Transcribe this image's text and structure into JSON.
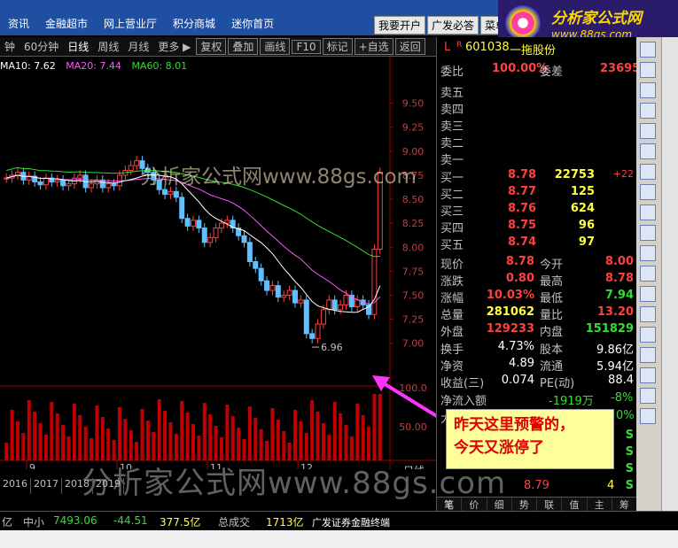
{
  "topbar": {
    "nav": [
      "资讯",
      "金融超市",
      "网上营业厅",
      "积分商城",
      "迷你首页"
    ],
    "right_buttons": [
      "我要开户",
      "广发必答",
      "菜单"
    ]
  },
  "logo": {
    "title": "分析家公式网",
    "url": "www.88gs.com"
  },
  "toolbar": {
    "items": [
      "钟",
      "60分钟",
      "日线",
      "周线",
      "月线",
      "更多 ▶"
    ],
    "active": "日线",
    "buttons": [
      "复权",
      "叠加",
      "画线",
      "F10",
      "标记",
      "+自选",
      "返回"
    ]
  },
  "ma_legend": [
    {
      "label": "MA10: 7.62",
      "color": "#ffffff"
    },
    {
      "label": "MA20: 7.44",
      "color": "#ff55ff"
    },
    {
      "label": "MA60: 8.01",
      "color": "#33dd33"
    }
  ],
  "chart_data": {
    "type": "candlestick",
    "y_ticks": [
      "9.50",
      "9.25",
      "9.00",
      "8.75",
      "8.50",
      "8.25",
      "8.00",
      "7.75",
      "7.50",
      "7.25",
      "7.00"
    ],
    "ylim": [
      6.85,
      9.8
    ],
    "low_marker": "6.96",
    "volume_ticks": [
      "100.0",
      "50.00"
    ],
    "x_month_labels": [
      "9",
      "10",
      "11",
      "12"
    ],
    "period_labels": [
      "2016",
      "2017",
      "2018",
      "2019"
    ],
    "period_label": "日线",
    "closes": [
      8.72,
      8.75,
      8.78,
      8.7,
      8.74,
      8.68,
      8.65,
      8.72,
      8.68,
      8.7,
      8.64,
      8.66,
      8.72,
      8.75,
      8.62,
      8.66,
      8.7,
      8.62,
      8.66,
      8.64,
      8.75,
      8.8,
      8.85,
      8.9,
      8.82,
      8.78,
      8.7,
      8.6,
      8.55,
      8.58,
      8.52,
      8.3,
      8.22,
      8.28,
      8.2,
      8.05,
      8.1,
      8.2,
      8.25,
      8.28,
      8.2,
      8.12,
      8.05,
      7.85,
      7.78,
      7.65,
      7.55,
      7.6,
      7.48,
      7.5,
      7.55,
      7.42,
      7.45,
      7.1,
      7.05,
      7.2,
      7.35,
      7.45,
      7.35,
      7.4,
      7.5,
      7.38,
      7.45,
      7.4,
      7.3,
      7.98,
      8.78
    ]
  },
  "quote": {
    "code": "601038",
    "name": "一拖股份",
    "weibi": "100.00%",
    "weicha": "23695",
    "sells": [
      "卖五",
      "卖四",
      "卖三",
      "卖二",
      "卖一"
    ],
    "buys": [
      {
        "label": "买一",
        "price": "8.78",
        "vol": "22753",
        "chg": "+22"
      },
      {
        "label": "买二",
        "price": "8.77",
        "vol": "125",
        "chg": ""
      },
      {
        "label": "买三",
        "price": "8.76",
        "vol": "624",
        "chg": ""
      },
      {
        "label": "买四",
        "price": "8.75",
        "vol": "96",
        "chg": ""
      },
      {
        "label": "买五",
        "price": "8.74",
        "vol": "97",
        "chg": ""
      }
    ],
    "stats": [
      {
        "l1": "现价",
        "v1": "8.78",
        "l2": "今开",
        "v2": "8.00"
      },
      {
        "l1": "涨跌",
        "v1": "0.80",
        "l2": "最高",
        "v2": "8.78"
      },
      {
        "l1": "涨幅",
        "v1": "10.03%",
        "l2": "最低",
        "v2": "7.94"
      },
      {
        "l1": "总量",
        "v1": "281062",
        "l2": "量比",
        "v2": "13.20"
      },
      {
        "l1": "外盘",
        "v1": "129233",
        "l2": "内盘",
        "v2": "151829"
      }
    ],
    "fund": [
      {
        "l1": "换手",
        "v1": "4.73%",
        "l2": "股本",
        "v2": "9.86亿"
      },
      {
        "l1": "净资",
        "v1": "4.89",
        "l2": "流通",
        "v2": "5.94亿"
      },
      {
        "l1": "收益(三)",
        "v1": "0.074",
        "l2": "PE(动)",
        "v2": "88.4"
      }
    ],
    "flow_label": "净流入额",
    "flow_value": "-1919万",
    "flow_pct": "-8%",
    "flow_pct2": "0%",
    "da_label": "大",
    "trade_rows": [
      {
        "price": "",
        "vol": "",
        "side": "S"
      },
      {
        "price": "",
        "vol": "",
        "side": "S"
      },
      {
        "price": "",
        "vol": "",
        "side": "S"
      },
      {
        "price": "8.79",
        "vol": "4",
        "side": "S"
      }
    ],
    "tabs": [
      "笔",
      "价",
      "细",
      "势",
      "联",
      "值",
      "主",
      "筹"
    ]
  },
  "callout": {
    "line1": "昨天这里预警的，",
    "line2": "今天又涨停了"
  },
  "watermark": "分析家公式网www.88gs.com",
  "watermark_bottom": "分析家公式网www.88gs.com",
  "bottom": {
    "left_val": "亿",
    "zhongxiao": "中小",
    "index_val": "7493.06",
    "index_chg": "-44.51",
    "amount": "377.5亿",
    "total_label": "总成交",
    "total_val": "1713亿",
    "broker": "广发证券金融终端"
  },
  "sidebar_icons": [
    "arrow-up-icon",
    "arrow-down-icon",
    "list-icon",
    "grid-icon",
    "chart-line-icon",
    "candle-icon",
    "table-icon",
    "f10-icon",
    "doc-icon",
    "f12-icon",
    "refresh-icon",
    "chart-icon",
    "rsi-icon",
    "tools-icon",
    "move-icon",
    "pen-icon",
    "gear-icon",
    "f5-icon",
    "f2-icon"
  ]
}
